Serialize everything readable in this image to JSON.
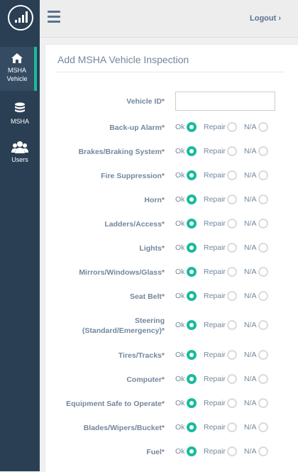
{
  "sidebar": {
    "nav": [
      {
        "label_line1": "MSHA",
        "label_line2": "Vehicle",
        "icon": "home-icon",
        "active": true
      },
      {
        "label_line1": "MSHA",
        "label_line2": "",
        "icon": "database-icon",
        "active": false
      },
      {
        "label_line1": "Users",
        "label_line2": "",
        "icon": "users-icon",
        "active": false
      }
    ]
  },
  "topbar": {
    "logout_label": "Logout",
    "logout_chevron": "›"
  },
  "form": {
    "title": "Add MSHA Vehicle Inspection",
    "vehicle_id_label": "Vehicle ID*",
    "vehicle_id_value": "",
    "options": {
      "ok": "Ok",
      "repair": "Repair",
      "na": "N/A"
    },
    "rows": [
      {
        "label": "Back-up Alarm*",
        "selected": "ok"
      },
      {
        "label": "Brakes/Braking System*",
        "selected": "ok"
      },
      {
        "label": "Fire Suppression*",
        "selected": "ok"
      },
      {
        "label": "Horn*",
        "selected": "ok"
      },
      {
        "label": "Ladders/Access*",
        "selected": "ok"
      },
      {
        "label": "Lights*",
        "selected": "ok"
      },
      {
        "label": "Mirrors/Windows/Glass*",
        "selected": "ok"
      },
      {
        "label": "Seat Belt*",
        "selected": "ok"
      },
      {
        "label": "Steering",
        "label_line2": "(Standard/Emergency)*",
        "selected": "ok"
      },
      {
        "label": "Tires/Tracks*",
        "selected": "ok"
      },
      {
        "label": "Computer*",
        "selected": "ok"
      },
      {
        "label": "Equipment Safe to Operate*",
        "selected": "ok"
      },
      {
        "label": "Blades/Wipers/Bucket*",
        "selected": "ok"
      },
      {
        "label": "Fuel*",
        "selected": "ok"
      }
    ]
  },
  "colors": {
    "accent": "#1abb9c",
    "sidebar": "#2a3f54",
    "text": "#73879c"
  }
}
